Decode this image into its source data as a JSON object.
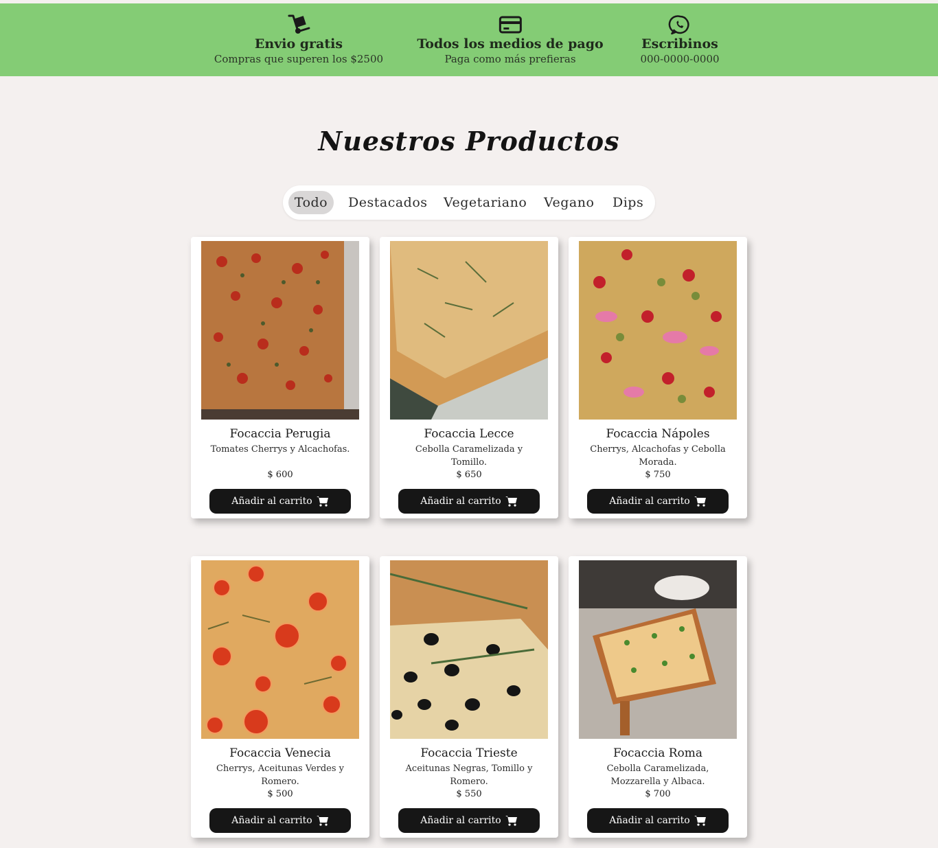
{
  "features": [
    {
      "icon": "hand-truck-icon",
      "title": "Envio gratis",
      "subtitle": "Compras que superen los $2500"
    },
    {
      "icon": "credit-card-icon",
      "title": "Todos los medios de pago",
      "subtitle": "Paga como más prefieras"
    },
    {
      "icon": "whatsapp-icon",
      "title": "Escribinos",
      "subtitle": "000-0000-0000"
    }
  ],
  "heading": "Nuestros Productos",
  "tabs": [
    {
      "label": "Todo",
      "active": true
    },
    {
      "label": "Destacados",
      "active": false
    },
    {
      "label": "Vegetariano",
      "active": false
    },
    {
      "label": "Vegano",
      "active": false
    },
    {
      "label": "Dips",
      "active": false
    }
  ],
  "products": [
    {
      "name": "Focaccia Perugia",
      "desc": "Tomates Cherrys y Alcachofas.",
      "price": "$ 600",
      "button": "Añadir al carrito"
    },
    {
      "name": "Focaccia Lecce",
      "desc": "Cebolla Caramelizada y Tomillo.",
      "price": "$ 650",
      "button": "Añadir al carrito"
    },
    {
      "name": "Focaccia Nápoles",
      "desc": "Cherrys, Alcachofas y Cebolla Morada.",
      "price": "$ 750",
      "button": "Añadir al carrito"
    },
    {
      "name": "Focaccia Venecia",
      "desc": "Cherrys, Aceitunas Verdes y Romero.",
      "price": "$ 500",
      "button": "Añadir al carrito"
    },
    {
      "name": "Focaccia Trieste",
      "desc": "Aceitunas Negras, Tomillo y Romero.",
      "price": "$ 550",
      "button": "Añadir al carrito"
    },
    {
      "name": "Focaccia Roma",
      "desc": "Cebolla Caramelizada, Mozzarella y Albaca.",
      "price": "$ 700",
      "button": "Añadir al carrito"
    }
  ],
  "colors": {
    "topbar": "#84cc75",
    "background": "#f4f0ef",
    "button": "#161616"
  }
}
